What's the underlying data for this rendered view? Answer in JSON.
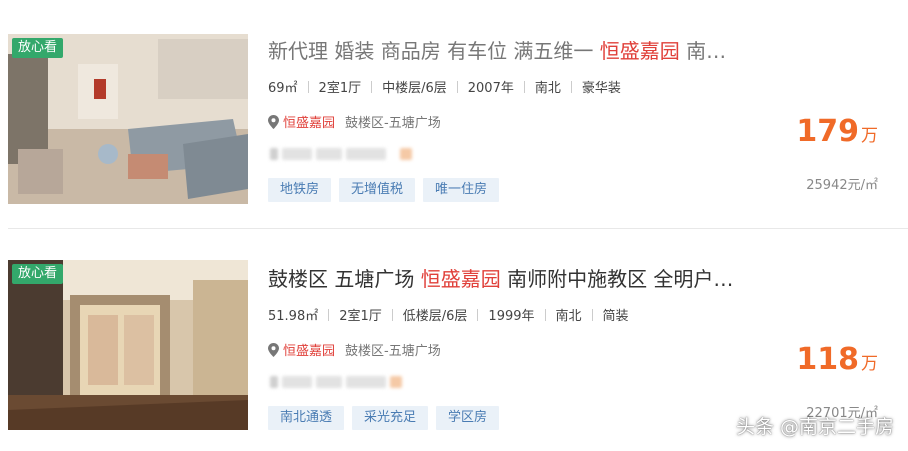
{
  "listings": [
    {
      "badge": "放心看",
      "title_before": "新代理 婚装 商品房 有车位 满五维一 ",
      "title_highlight": "恒盛嘉园",
      "title_after": " 南…",
      "attrs": [
        "69㎡",
        "2室1厅",
        "中楼层/6层",
        "2007年",
        "南北",
        "豪华装"
      ],
      "community": "恒盛嘉园",
      "district": "鼓楼区-五塘广场",
      "tags": [
        "地铁房",
        "无增值税",
        "唯一住房"
      ],
      "price": "179",
      "price_unit": "万",
      "unit_price": "25942元/㎡"
    },
    {
      "badge": "放心看",
      "title_before": "鼓楼区 五塘广场 ",
      "title_highlight": "恒盛嘉园",
      "title_after": " 南师附中施教区 全明户…",
      "attrs": [
        "51.98㎡",
        "2室1厅",
        "低楼层/6层",
        "1999年",
        "南北",
        "简装"
      ],
      "community": "恒盛嘉园",
      "district": "鼓楼区-五塘广场",
      "tags": [
        "南北通透",
        "采光充足",
        "学区房"
      ],
      "price": "118",
      "price_unit": "万",
      "unit_price": "22701元/㎡"
    }
  ],
  "watermark": "头条 @南京二手房",
  "colors": {
    "highlight": "#e0403a",
    "price": "#f06a28",
    "badge": "#33a86b",
    "tag_text": "#4a7cb3",
    "tag_bg": "#eaf1f8"
  },
  "icons": {
    "location": "map-pin-icon"
  }
}
